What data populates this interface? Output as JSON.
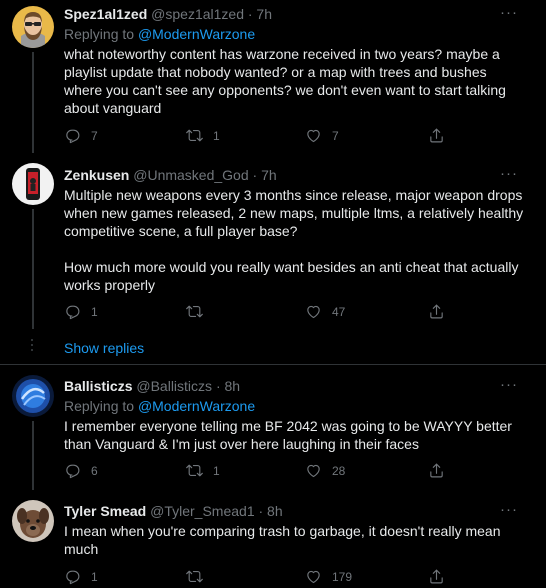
{
  "tweets": [
    {
      "name": "Spez1al1zed",
      "handle": "@spez1al1zed",
      "time": "· 7h",
      "replying_prefix": "Replying to",
      "replying_to": "@ModernWarzone",
      "text": "what noteworthy content has warzone received in two years? maybe a playlist update that nobody wanted? or a map with trees and bushes where you can't see any opponents? we don't even want to start talking about vanguard",
      "replies": "7",
      "retweets": "1",
      "likes": "7",
      "avatar_icon": "bearded-man-avatar-icon"
    },
    {
      "name": "Zenkusen",
      "handle": "@Unmasked_God",
      "time": "· 7h",
      "text_1": "Multiple new weapons every 3 months since release, major weapon drops when new games released, 2 new maps, multiple ltms, a relatively healthy competitive scene, a full player base?",
      "text_2": "How much more would you really want besides an anti cheat that actually works properly",
      "replies": "1",
      "retweets": "",
      "likes": "47",
      "avatar_icon": "phone-avatar-icon"
    },
    {
      "name": "Ballisticzs",
      "handle": "@Ballisticzs",
      "time": "· 8h",
      "replying_prefix": "Replying to",
      "replying_to": "@ModernWarzone",
      "text": "I remember everyone telling me BF 2042 was going to be WAYYY better than Vanguard & I'm just over here laughing in their faces",
      "replies": "6",
      "retweets": "1",
      "likes": "28",
      "avatar_icon": "blue-orb-avatar-icon"
    },
    {
      "name": "Tyler Smead",
      "handle": "@Tyler_Smead1",
      "time": "· 8h",
      "text": "I mean when you're comparing trash to garbage, it doesn't really mean much",
      "replies": "1",
      "retweets": "",
      "likes": "179",
      "avatar_icon": "dog-avatar-icon"
    }
  ],
  "show_replies": "Show replies",
  "more_label": "···",
  "colors": {
    "background": "#000000",
    "text": "#e7e9ea",
    "secondary": "#71767b",
    "link": "#1d9bf0",
    "divider": "#2f3336"
  }
}
